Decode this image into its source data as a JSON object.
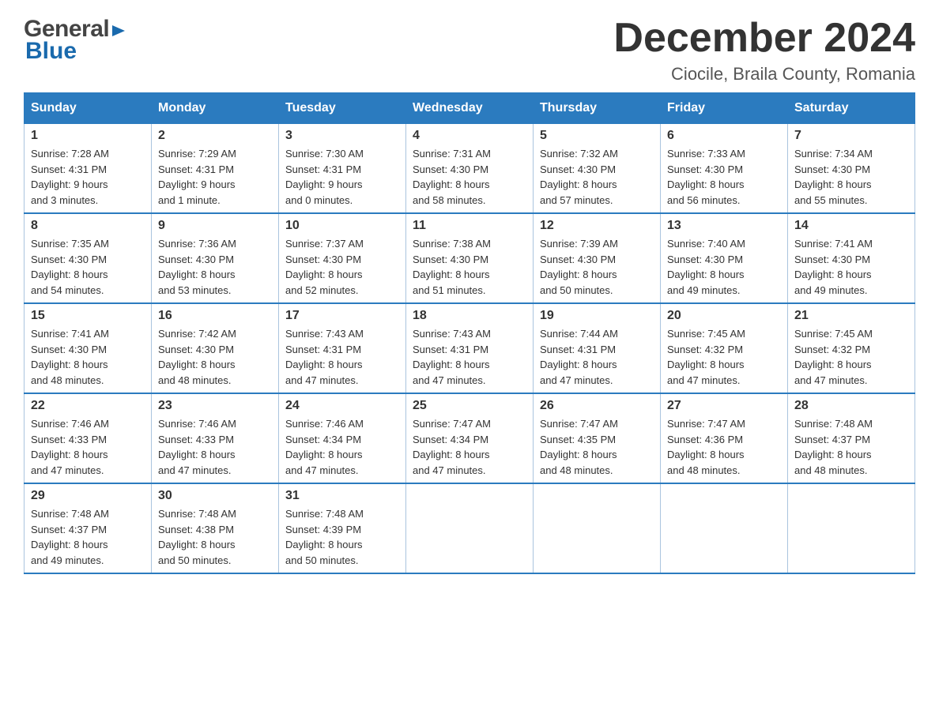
{
  "header": {
    "logo_general": "General",
    "logo_blue": "Blue",
    "month_title": "December 2024",
    "location": "Ciocile, Braila County, Romania"
  },
  "days_of_week": [
    "Sunday",
    "Monday",
    "Tuesday",
    "Wednesday",
    "Thursday",
    "Friday",
    "Saturday"
  ],
  "weeks": [
    [
      {
        "day": "1",
        "sunrise": "7:28 AM",
        "sunset": "4:31 PM",
        "daylight": "9 hours and 3 minutes."
      },
      {
        "day": "2",
        "sunrise": "7:29 AM",
        "sunset": "4:31 PM",
        "daylight": "9 hours and 1 minute."
      },
      {
        "day": "3",
        "sunrise": "7:30 AM",
        "sunset": "4:31 PM",
        "daylight": "9 hours and 0 minutes."
      },
      {
        "day": "4",
        "sunrise": "7:31 AM",
        "sunset": "4:30 PM",
        "daylight": "8 hours and 58 minutes."
      },
      {
        "day": "5",
        "sunrise": "7:32 AM",
        "sunset": "4:30 PM",
        "daylight": "8 hours and 57 minutes."
      },
      {
        "day": "6",
        "sunrise": "7:33 AM",
        "sunset": "4:30 PM",
        "daylight": "8 hours and 56 minutes."
      },
      {
        "day": "7",
        "sunrise": "7:34 AM",
        "sunset": "4:30 PM",
        "daylight": "8 hours and 55 minutes."
      }
    ],
    [
      {
        "day": "8",
        "sunrise": "7:35 AM",
        "sunset": "4:30 PM",
        "daylight": "8 hours and 54 minutes."
      },
      {
        "day": "9",
        "sunrise": "7:36 AM",
        "sunset": "4:30 PM",
        "daylight": "8 hours and 53 minutes."
      },
      {
        "day": "10",
        "sunrise": "7:37 AM",
        "sunset": "4:30 PM",
        "daylight": "8 hours and 52 minutes."
      },
      {
        "day": "11",
        "sunrise": "7:38 AM",
        "sunset": "4:30 PM",
        "daylight": "8 hours and 51 minutes."
      },
      {
        "day": "12",
        "sunrise": "7:39 AM",
        "sunset": "4:30 PM",
        "daylight": "8 hours and 50 minutes."
      },
      {
        "day": "13",
        "sunrise": "7:40 AM",
        "sunset": "4:30 PM",
        "daylight": "8 hours and 49 minutes."
      },
      {
        "day": "14",
        "sunrise": "7:41 AM",
        "sunset": "4:30 PM",
        "daylight": "8 hours and 49 minutes."
      }
    ],
    [
      {
        "day": "15",
        "sunrise": "7:41 AM",
        "sunset": "4:30 PM",
        "daylight": "8 hours and 48 minutes."
      },
      {
        "day": "16",
        "sunrise": "7:42 AM",
        "sunset": "4:30 PM",
        "daylight": "8 hours and 48 minutes."
      },
      {
        "day": "17",
        "sunrise": "7:43 AM",
        "sunset": "4:31 PM",
        "daylight": "8 hours and 47 minutes."
      },
      {
        "day": "18",
        "sunrise": "7:43 AM",
        "sunset": "4:31 PM",
        "daylight": "8 hours and 47 minutes."
      },
      {
        "day": "19",
        "sunrise": "7:44 AM",
        "sunset": "4:31 PM",
        "daylight": "8 hours and 47 minutes."
      },
      {
        "day": "20",
        "sunrise": "7:45 AM",
        "sunset": "4:32 PM",
        "daylight": "8 hours and 47 minutes."
      },
      {
        "day": "21",
        "sunrise": "7:45 AM",
        "sunset": "4:32 PM",
        "daylight": "8 hours and 47 minutes."
      }
    ],
    [
      {
        "day": "22",
        "sunrise": "7:46 AM",
        "sunset": "4:33 PM",
        "daylight": "8 hours and 47 minutes."
      },
      {
        "day": "23",
        "sunrise": "7:46 AM",
        "sunset": "4:33 PM",
        "daylight": "8 hours and 47 minutes."
      },
      {
        "day": "24",
        "sunrise": "7:46 AM",
        "sunset": "4:34 PM",
        "daylight": "8 hours and 47 minutes."
      },
      {
        "day": "25",
        "sunrise": "7:47 AM",
        "sunset": "4:34 PM",
        "daylight": "8 hours and 47 minutes."
      },
      {
        "day": "26",
        "sunrise": "7:47 AM",
        "sunset": "4:35 PM",
        "daylight": "8 hours and 48 minutes."
      },
      {
        "day": "27",
        "sunrise": "7:47 AM",
        "sunset": "4:36 PM",
        "daylight": "8 hours and 48 minutes."
      },
      {
        "day": "28",
        "sunrise": "7:48 AM",
        "sunset": "4:37 PM",
        "daylight": "8 hours and 48 minutes."
      }
    ],
    [
      {
        "day": "29",
        "sunrise": "7:48 AM",
        "sunset": "4:37 PM",
        "daylight": "8 hours and 49 minutes."
      },
      {
        "day": "30",
        "sunrise": "7:48 AM",
        "sunset": "4:38 PM",
        "daylight": "8 hours and 50 minutes."
      },
      {
        "day": "31",
        "sunrise": "7:48 AM",
        "sunset": "4:39 PM",
        "daylight": "8 hours and 50 minutes."
      },
      null,
      null,
      null,
      null
    ]
  ],
  "labels": {
    "sunrise": "Sunrise:",
    "sunset": "Sunset:",
    "daylight": "Daylight:"
  }
}
